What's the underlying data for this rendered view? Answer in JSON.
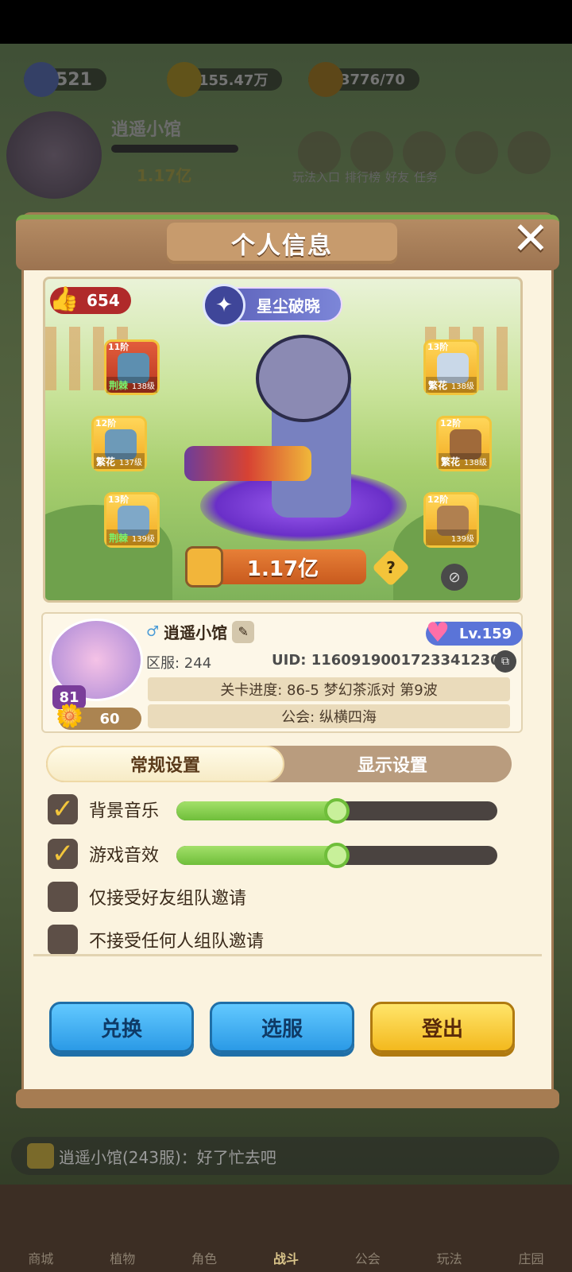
{
  "background": {
    "resources": {
      "gems": "521",
      "gold": "155.47万",
      "energy": "3776/70"
    },
    "player_name": "逍遥小馆",
    "player_level": "81",
    "player_power": "1.17亿",
    "menu_labels": [
      "玩法入口",
      "排行榜",
      "好友",
      "任务"
    ],
    "chat_text": "逍遥小馆(243服)：好了忙去吧",
    "nav": [
      "商城",
      "植物",
      "角色",
      "战斗",
      "公会",
      "玩法",
      "庄园"
    ]
  },
  "panel": {
    "title": "个人信息",
    "close_symbol": "✕"
  },
  "scene": {
    "likes": "654",
    "title_tag": "星尘破晓",
    "power": "1.17亿",
    "help": "?",
    "equipment": [
      {
        "tier": "11阶",
        "quality": "荆棘",
        "level": "138级",
        "style": "red"
      },
      {
        "tier": "12阶",
        "quality": "繁花",
        "level": "137级",
        "style": "gold"
      },
      {
        "tier": "13阶",
        "quality": "荆棘",
        "level": "139级",
        "style": "gold"
      },
      {
        "tier": "13阶",
        "quality": "繁花",
        "level": "138级",
        "style": "gold"
      },
      {
        "tier": "12阶",
        "quality": "繁花",
        "level": "138级",
        "style": "gold"
      },
      {
        "tier": "12阶",
        "quality": "",
        "level": "139级",
        "style": "gold"
      }
    ]
  },
  "info": {
    "name": "逍遥小馆",
    "level_badge": "Lv.159",
    "avatar_level": "81",
    "flowers": "60",
    "server": "区服: 244",
    "uid": "UID: 1160919001723341230",
    "progress": "关卡进度: 86-5 梦幻茶派对 第9波",
    "guild": "公会: 纵横四海"
  },
  "tabs": {
    "general": "常规设置",
    "display": "显示设置"
  },
  "settings": {
    "bgm": {
      "label": "背景音乐",
      "checked": true,
      "volume": 0.5
    },
    "sfx": {
      "label": "游戏音效",
      "checked": true,
      "volume": 0.5
    },
    "friends_only": {
      "label": "仅接受好友组队邀请",
      "checked": false
    },
    "no_invites": {
      "label": "不接受任何人组队邀请",
      "checked": false
    }
  },
  "buttons": {
    "redeem": "兑换",
    "select_server": "选服",
    "logout": "登出"
  },
  "colors": {
    "panel": "#fbf3df",
    "header": "#9c7350",
    "blue_button": "#2b9ae6",
    "yellow_button": "#f3b91e",
    "slider_fill": "#6fbe3a"
  }
}
